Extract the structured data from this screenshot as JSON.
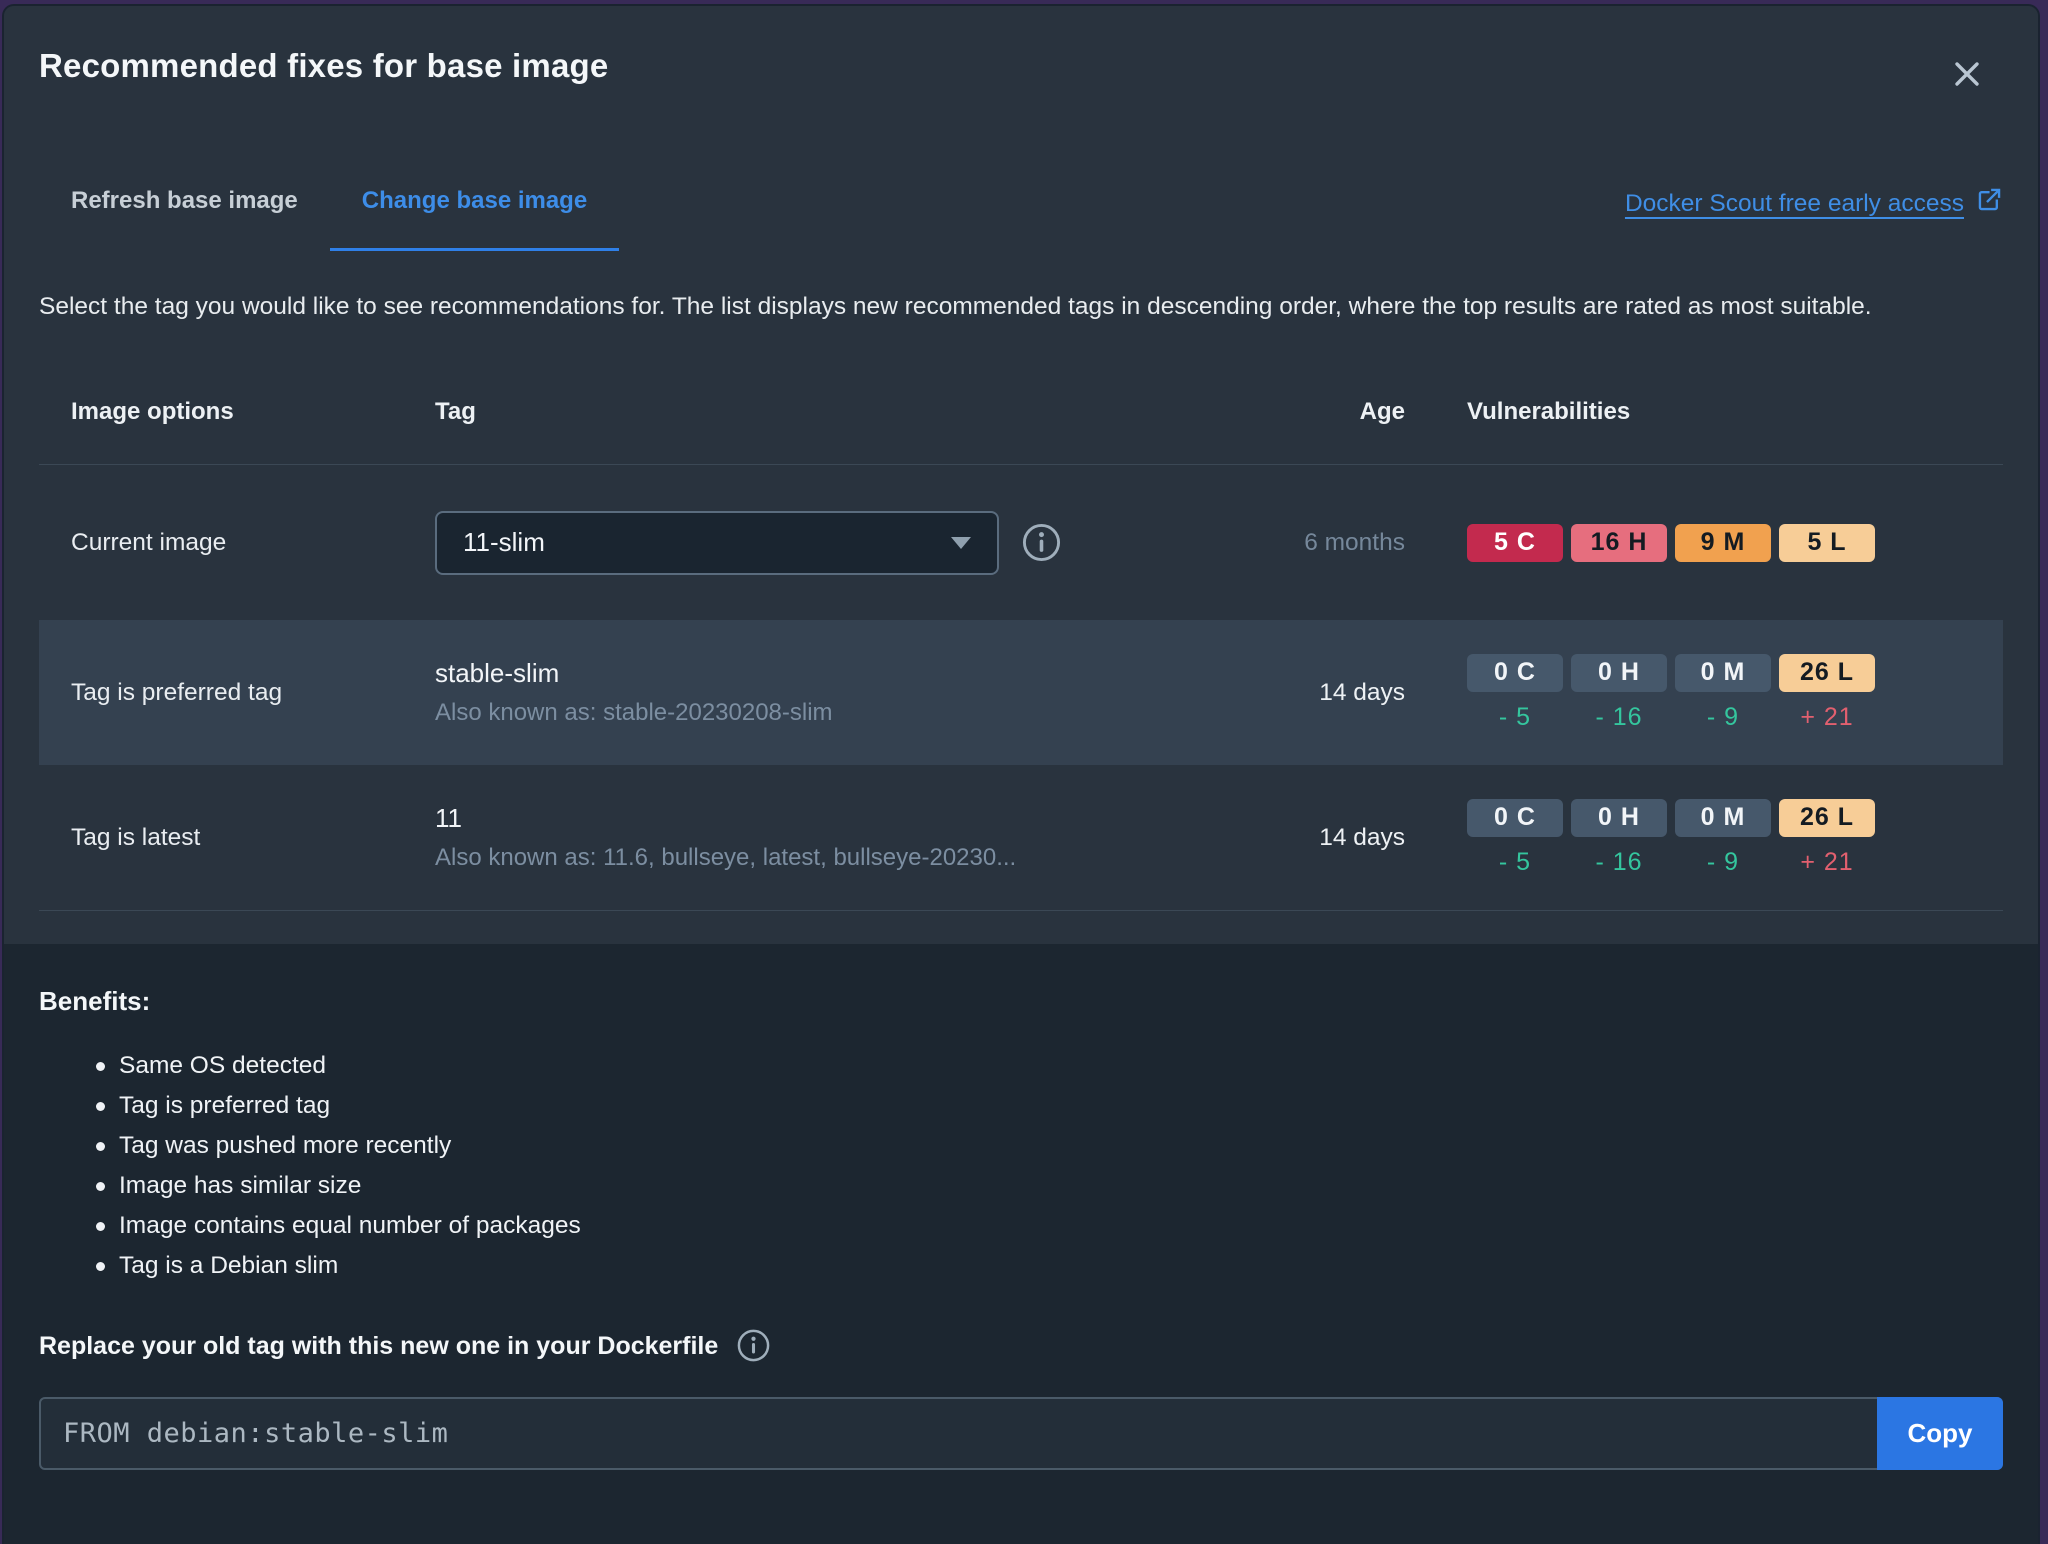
{
  "dialog": {
    "title": "Recommended fixes for base image"
  },
  "tabs": {
    "refresh": "Refresh base image",
    "change": "Change base image"
  },
  "header_link": {
    "label": "Docker Scout free early access"
  },
  "description": "Select the tag you would like to see recommendations for. The list displays new recommended tags in descending order, where the top results are rated as most suitable.",
  "table": {
    "headers": {
      "image_options": "Image options",
      "tag": "Tag",
      "age": "Age",
      "vulnerabilities": "Vulnerabilities"
    },
    "current": {
      "label": "Current image",
      "selected_tag": "11-slim",
      "age": "6 months",
      "badges": [
        {
          "label": "5 C",
          "severity": "critical"
        },
        {
          "label": "16 H",
          "severity": "high"
        },
        {
          "label": "9 M",
          "severity": "medium"
        },
        {
          "label": "5 L",
          "severity": "low"
        }
      ]
    },
    "recommendations": [
      {
        "label": "Tag is preferred tag",
        "tag": "stable-slim",
        "aka": "Also known as: stable-20230208-slim",
        "age": "14 days",
        "badges": [
          {
            "label": "0 C",
            "severity": "none",
            "delta": "- 5",
            "trend": "down"
          },
          {
            "label": "0 H",
            "severity": "none",
            "delta": "- 16",
            "trend": "down"
          },
          {
            "label": "0 M",
            "severity": "none",
            "delta": "- 9",
            "trend": "down"
          },
          {
            "label": "26 L",
            "severity": "low",
            "delta": "+ 21",
            "trend": "up"
          }
        ]
      },
      {
        "label": "Tag is latest",
        "tag": "11",
        "aka": "Also known as: 11.6, bullseye, latest, bullseye-20230...",
        "age": "14 days",
        "badges": [
          {
            "label": "0 C",
            "severity": "none",
            "delta": "- 5",
            "trend": "down"
          },
          {
            "label": "0 H",
            "severity": "none",
            "delta": "- 16",
            "trend": "down"
          },
          {
            "label": "0 M",
            "severity": "none",
            "delta": "- 9",
            "trend": "down"
          },
          {
            "label": "26 L",
            "severity": "low",
            "delta": "+ 21",
            "trend": "up"
          }
        ]
      }
    ]
  },
  "benefits": {
    "title": "Benefits:",
    "items": [
      "Same OS detected",
      "Tag is preferred tag",
      "Tag was pushed more recently",
      "Image has similar size",
      "Image contains equal number of packages",
      "Tag is a Debian slim"
    ]
  },
  "dockerfile": {
    "heading": "Replace your old tag with this new one in your Dockerfile",
    "command": "FROM debian:stable-slim",
    "copy_label": "Copy"
  },
  "colors": {
    "accent_blue": "#3D8DE8",
    "copy_blue": "#2B76E3",
    "critical": "#C32A4E",
    "high": "#E66E7E",
    "medium": "#F1A14F",
    "low": "#F7CD97",
    "none_badge": "#46586B",
    "delta_down": "#34C69E",
    "delta_up": "#E2606F",
    "top_bg": "#29333E",
    "bottom_bg": "#1C2630",
    "highlight_row": "#344150",
    "backdrop": "#382A57"
  }
}
